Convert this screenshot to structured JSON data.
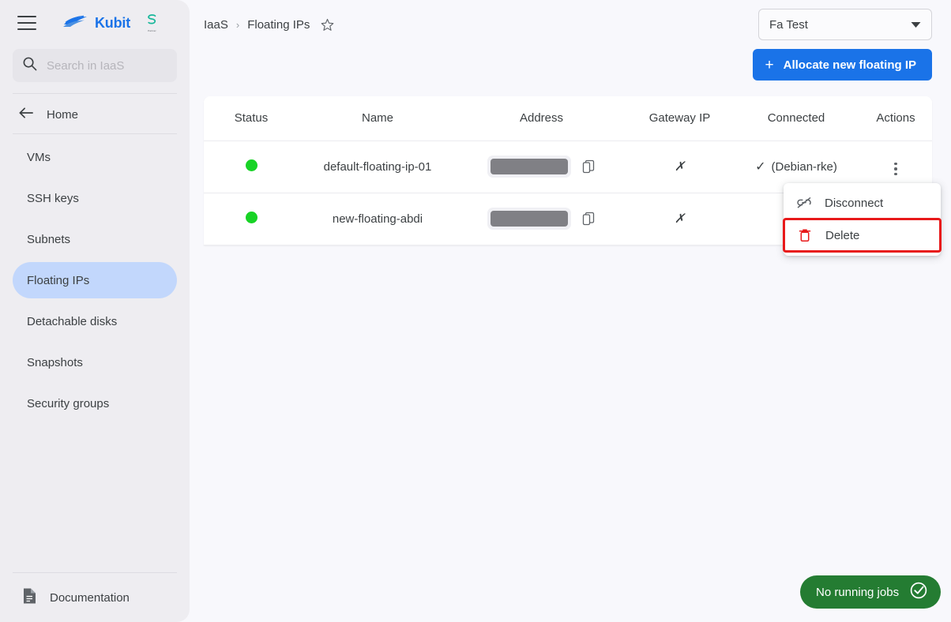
{
  "sidebar": {
    "menu_icon": "hamburger-icon",
    "brand": {
      "name": "Kubit",
      "logo_icon": "kubit-wave-logo"
    },
    "partner": {
      "mark": "S",
      "sub_text": "Partner"
    },
    "search": {
      "placeholder": "Search in IaaS",
      "value": "",
      "icon": "search-icon"
    },
    "home": {
      "label": "Home",
      "icon": "arrow-left-icon"
    },
    "items": [
      {
        "label": "VMs",
        "active": false
      },
      {
        "label": "SSH keys",
        "active": false
      },
      {
        "label": "Subnets",
        "active": false
      },
      {
        "label": "Floating IPs",
        "active": true
      },
      {
        "label": "Detachable disks",
        "active": false
      },
      {
        "label": "Snapshots",
        "active": false
      },
      {
        "label": "Security groups",
        "active": false
      }
    ],
    "documentation": {
      "label": "Documentation",
      "icon": "document-icon"
    }
  },
  "header": {
    "breadcrumb": {
      "root": "IaaS",
      "separator": "›",
      "current": "Floating IPs",
      "favorite_icon": "star-outline-icon"
    },
    "project_select": {
      "value": "Fa Test",
      "caret_icon": "chevron-down-icon"
    },
    "allocate_button": {
      "label": "Allocate new floating IP",
      "icon": "plus-icon"
    }
  },
  "table": {
    "columns": [
      "Status",
      "Name",
      "Address",
      "Gateway IP",
      "Connected",
      "Actions"
    ],
    "rows": [
      {
        "status": "active",
        "status_icon": "green-dot-icon",
        "name": "default-floating-ip-01",
        "address": "",
        "address_redacted": true,
        "copy_icon": "copy-icon",
        "gateway_ip": "✗",
        "connected_mark": "✓",
        "connected_target": "(Debian-rke)",
        "actions_icon": "kebab-menu-icon"
      },
      {
        "status": "active",
        "status_icon": "green-dot-icon",
        "name": "new-floating-abdi",
        "address": "",
        "address_redacted": true,
        "copy_icon": "copy-icon",
        "gateway_ip": "✗",
        "connected_mark": "",
        "connected_target": "",
        "actions_icon": "kebab-menu-icon"
      }
    ]
  },
  "context_menu": {
    "items": [
      {
        "label": "Disconnect",
        "icon": "link-off-icon",
        "highlighted": false
      },
      {
        "label": "Delete",
        "icon": "trash-icon",
        "highlighted": true
      }
    ],
    "highlight_color": "#e8191a"
  },
  "status_pill": {
    "label": "No running jobs",
    "icon": "check-circle-icon",
    "color": "#247c32"
  },
  "colors": {
    "accent": "#1a73e8",
    "sidebar_bg": "#eeedf1",
    "canvas_bg": "#f8f8fc",
    "active_nav": "#c2d7fc",
    "status_green": "#18d326",
    "danger": "#e8191a"
  }
}
